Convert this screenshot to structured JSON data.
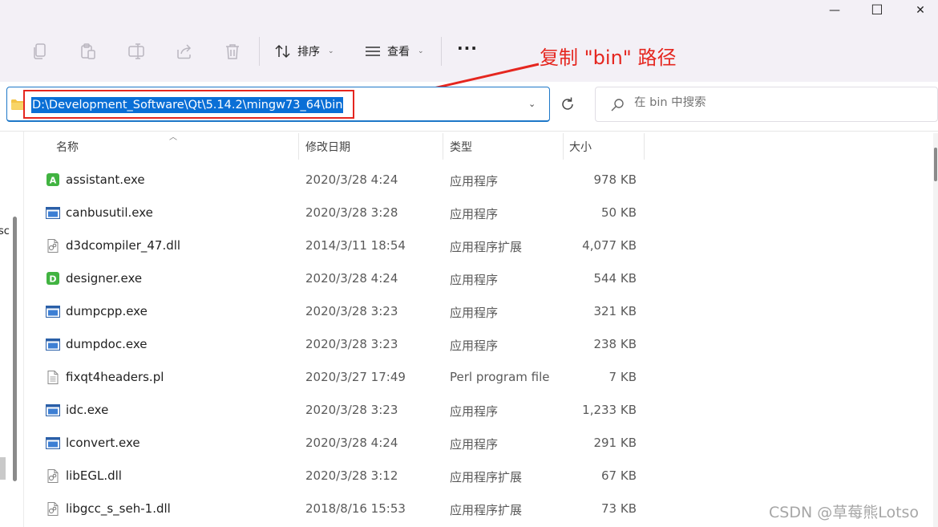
{
  "window": {
    "minimize_glyph": "—",
    "maximize_glyph": "☐",
    "close_glyph": "✕"
  },
  "toolbar": {
    "sort_label": "排序",
    "view_label": "查看",
    "more_label": "···",
    "icons": [
      "copy-icon",
      "paste-icon",
      "rename-icon",
      "share-icon",
      "delete-icon"
    ]
  },
  "annotation": {
    "text": "复制 \"bin\" 路径",
    "color": "#e5261f"
  },
  "address": {
    "path": "D:\\Development_Software\\Qt\\5.14.2\\mingw73_64\\bin"
  },
  "search": {
    "placeholder": "在 bin 中搜索"
  },
  "left_pane": {
    "partial_text": "sc"
  },
  "columns": {
    "name": "名称",
    "modified": "修改日期",
    "type": "类型",
    "size": "大小"
  },
  "files": [
    {
      "name": "assistant.exe",
      "modified": "2020/3/28 4:24",
      "type": "应用程序",
      "size": "978 KB",
      "icon": "assistant-app-icon"
    },
    {
      "name": "canbusutil.exe",
      "modified": "2020/3/28 3:28",
      "type": "应用程序",
      "size": "50 KB",
      "icon": "app-window-icon"
    },
    {
      "name": "d3dcompiler_47.dll",
      "modified": "2014/3/11 18:54",
      "type": "应用程序扩展",
      "size": "4,077 KB",
      "icon": "dll-file-icon"
    },
    {
      "name": "designer.exe",
      "modified": "2020/3/28 4:24",
      "type": "应用程序",
      "size": "544 KB",
      "icon": "designer-app-icon"
    },
    {
      "name": "dumpcpp.exe",
      "modified": "2020/3/28 3:23",
      "type": "应用程序",
      "size": "321 KB",
      "icon": "app-window-icon"
    },
    {
      "name": "dumpdoc.exe",
      "modified": "2020/3/28 3:23",
      "type": "应用程序",
      "size": "238 KB",
      "icon": "app-window-icon"
    },
    {
      "name": "fixqt4headers.pl",
      "modified": "2020/3/27 17:49",
      "type": "Perl program file",
      "size": "7 KB",
      "icon": "text-file-icon"
    },
    {
      "name": "idc.exe",
      "modified": "2020/3/28 3:23",
      "type": "应用程序",
      "size": "1,233 KB",
      "icon": "app-window-icon"
    },
    {
      "name": "lconvert.exe",
      "modified": "2020/3/28 4:24",
      "type": "应用程序",
      "size": "291 KB",
      "icon": "app-window-icon"
    },
    {
      "name": "libEGL.dll",
      "modified": "2020/3/28 3:12",
      "type": "应用程序扩展",
      "size": "67 KB",
      "icon": "dll-file-icon"
    },
    {
      "name": "libgcc_s_seh-1.dll",
      "modified": "2018/8/16 15:53",
      "type": "应用程序扩展",
      "size": "73 KB",
      "icon": "dll-file-icon"
    }
  ],
  "watermark": {
    "text": "CSDN @草莓熊Lotso"
  }
}
